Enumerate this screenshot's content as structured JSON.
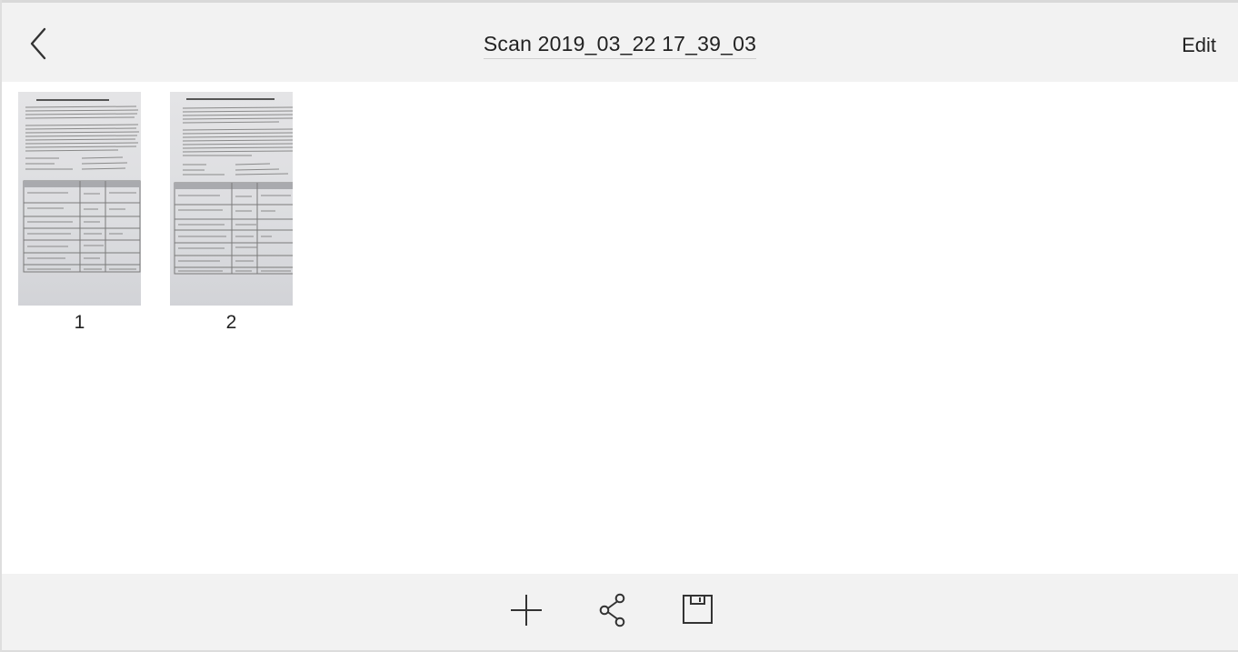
{
  "header": {
    "back_icon": "chevron-left-icon",
    "title": "Scan 2019_03_22 17_39_03",
    "edit_label": "Edit"
  },
  "pages": [
    {
      "number": "1"
    },
    {
      "number": "2"
    }
  ],
  "toolbar": {
    "add_icon": "plus-icon",
    "share_icon": "share-icon",
    "save_icon": "save-icon"
  },
  "colors": {
    "bar_background": "#f2f2f2",
    "text": "#222222",
    "icon": "#333333"
  }
}
